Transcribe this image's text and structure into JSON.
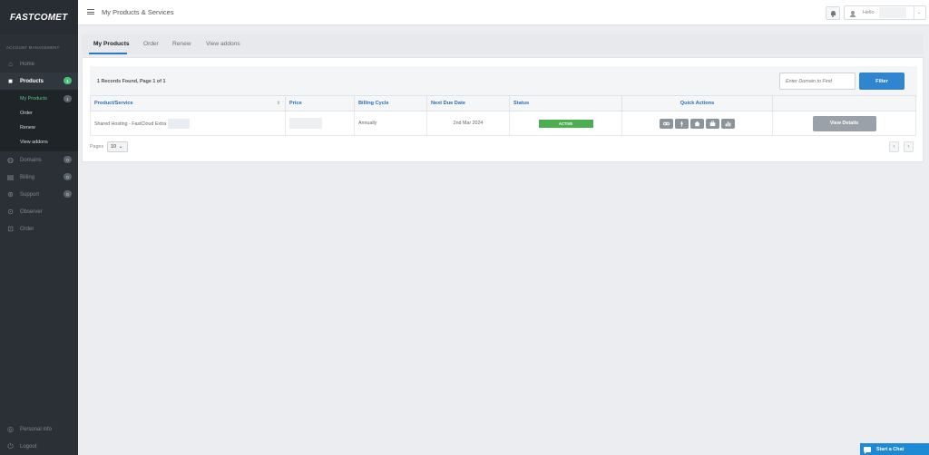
{
  "sidebar": {
    "logo": "FASTCOMET",
    "section_label": "ACCOUNT MANAGEMENT",
    "items": [
      {
        "label": "Home",
        "icon": "home-icon"
      },
      {
        "label": "Products",
        "icon": "box-icon",
        "badge": "1"
      },
      {
        "label": "Domains",
        "icon": "globe-icon",
        "badge": "0"
      },
      {
        "label": "Billing",
        "icon": "billing-icon",
        "badge": "0"
      },
      {
        "label": "Support",
        "icon": "lifebuoy-icon",
        "badge": "0"
      },
      {
        "label": "Observer",
        "icon": "observer-icon"
      },
      {
        "label": "Order",
        "icon": "order-icon"
      }
    ],
    "submenu": [
      {
        "label": "My Products",
        "badge": "1"
      },
      {
        "label": "Order"
      },
      {
        "label": "Renew"
      },
      {
        "label": "View addons"
      }
    ],
    "bottom": [
      {
        "label": "Personal info",
        "icon": "user-circle-icon"
      },
      {
        "label": "Logout",
        "icon": "power-icon"
      }
    ]
  },
  "header": {
    "title": "My Products & Services",
    "greeting": "Hello"
  },
  "tabs": [
    "My Products",
    "Order",
    "Renew",
    "View addons"
  ],
  "toolbar": {
    "records": "1 Records Found, Page 1 of 1",
    "filter_placeholder": "Enter Domain to Find",
    "filter_button": "Filter"
  },
  "table": {
    "columns": [
      "Product/Service",
      "Price",
      "Billing Cycle",
      "Next Due Date",
      "Status",
      "Quick Actions",
      ""
    ],
    "rows": [
      {
        "product": "Shared Hosting - FastCloud Extra",
        "price": "",
        "billing_cycle": "Annually",
        "next_due_date": "2nd Mar 2024",
        "status": "ACTIVE",
        "quick_actions": [
          "link-icon",
          "rocket-icon",
          "home-icon",
          "briefcase-icon",
          "chart-icon"
        ],
        "action_label": "View Details"
      }
    ]
  },
  "pagination": {
    "label": "Pages",
    "per_page": "10",
    "prev": "‹",
    "next": "›"
  },
  "chat": {
    "label": "Start a Chat"
  },
  "colors": {
    "sidebar_bg": "#2a3036",
    "accent_blue": "#2f85d0",
    "active_green": "#4cae4f",
    "badge_green": "#48c27a"
  }
}
